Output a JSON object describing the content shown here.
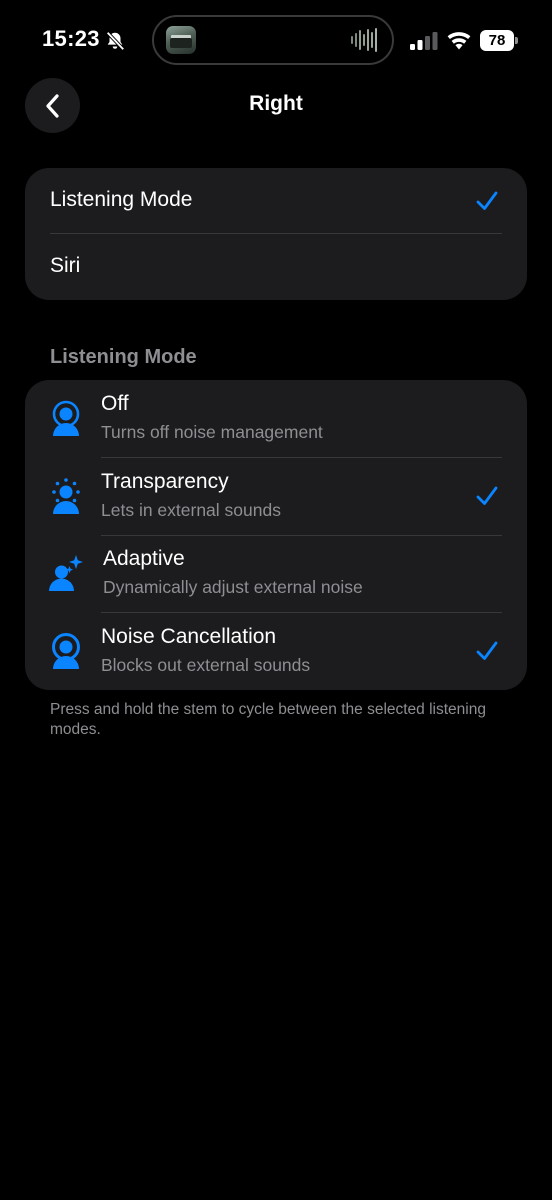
{
  "status_bar": {
    "time": "15:23",
    "battery_level": "78",
    "signal_bars_active": 2,
    "signal_bars_total": 4,
    "icons": [
      "bell-slash-icon",
      "waveform-icon",
      "signal-icon",
      "wifi-icon",
      "battery-icon"
    ]
  },
  "nav": {
    "title": "Right",
    "back_icon": "chevron-left-icon"
  },
  "press_options": [
    {
      "label": "Listening Mode",
      "selected": true
    },
    {
      "label": "Siri",
      "selected": false
    }
  ],
  "listening_mode_section": {
    "header": "Listening Mode",
    "modes": [
      {
        "title": "Off",
        "subtitle": "Turns off noise management",
        "selected": false,
        "icon": "person-off-icon"
      },
      {
        "title": "Transparency",
        "subtitle": "Lets in external sounds",
        "selected": true,
        "icon": "person-transparency-icon"
      },
      {
        "title": "Adaptive",
        "subtitle": "Dynamically adjust external noise",
        "selected": false,
        "icon": "person-adaptive-icon"
      },
      {
        "title": "Noise Cancellation",
        "subtitle": "Blocks out external sounds",
        "selected": true,
        "icon": "person-noise-cancellation-icon"
      }
    ],
    "footer": "Press and hold the stem to cycle between the selected listening modes."
  },
  "colors": {
    "background": "#000000",
    "card": "#1c1c1e",
    "accent": "#0a84ff",
    "secondary_text": "#8e8e93",
    "separator": "#38383a"
  }
}
